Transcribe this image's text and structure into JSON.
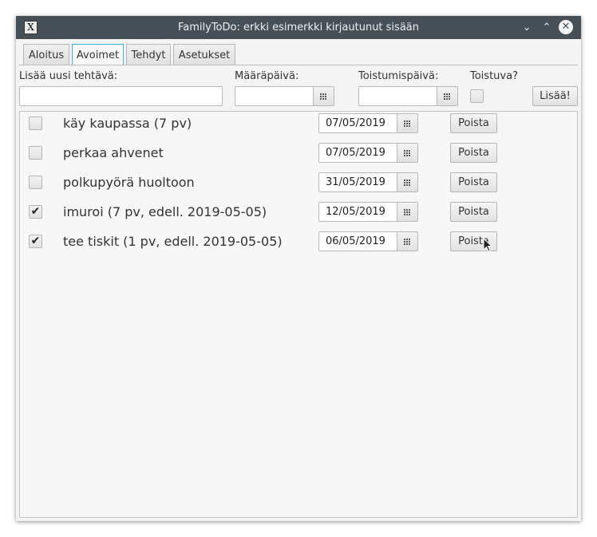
{
  "window": {
    "title": "FamilyToDo: erkki esimerkki kirjautunut sisään",
    "app_icon": "X",
    "controls": {
      "minimize": "⌄",
      "maximize": "⌃",
      "close": "✕"
    }
  },
  "tabs": [
    {
      "label": "Aloitus",
      "active": false
    },
    {
      "label": "Avoimet",
      "active": true
    },
    {
      "label": "Tehdyt",
      "active": false
    },
    {
      "label": "Asetukset",
      "active": false
    }
  ],
  "add_form": {
    "task_label": "Lisää uusi tehtävä:",
    "task_value": "",
    "due_label": "Määräpäivä:",
    "due_value": "",
    "repeat_date_label": "Toistumispäivä:",
    "repeat_date_value": "",
    "repeating_label": "Toistuva?",
    "repeating_checked": false,
    "add_button": "Lisää!"
  },
  "tasks": [
    {
      "text": "käy kaupassa (7 pv)",
      "done": false,
      "date": "07/05/2019",
      "delete_label": "Poista"
    },
    {
      "text": "perkaa ahvenet",
      "done": false,
      "date": "07/05/2019",
      "delete_label": "Poista"
    },
    {
      "text": "polkupyörä huoltoon",
      "done": false,
      "date": "31/05/2019",
      "delete_label": "Poista"
    },
    {
      "text": "imuroi (7 pv, edell. 2019-05-05)",
      "done": true,
      "date": "12/05/2019",
      "delete_label": "Poista"
    },
    {
      "text": "tee tiskit (1 pv, edell. 2019-05-05)",
      "done": true,
      "date": "06/05/2019",
      "delete_label": "Poista"
    }
  ],
  "icons": {
    "calendar": "calendar-icon",
    "checkmark": "✔"
  },
  "colors": {
    "titlebar": "#475057",
    "tab_focus": "#3daee9"
  }
}
